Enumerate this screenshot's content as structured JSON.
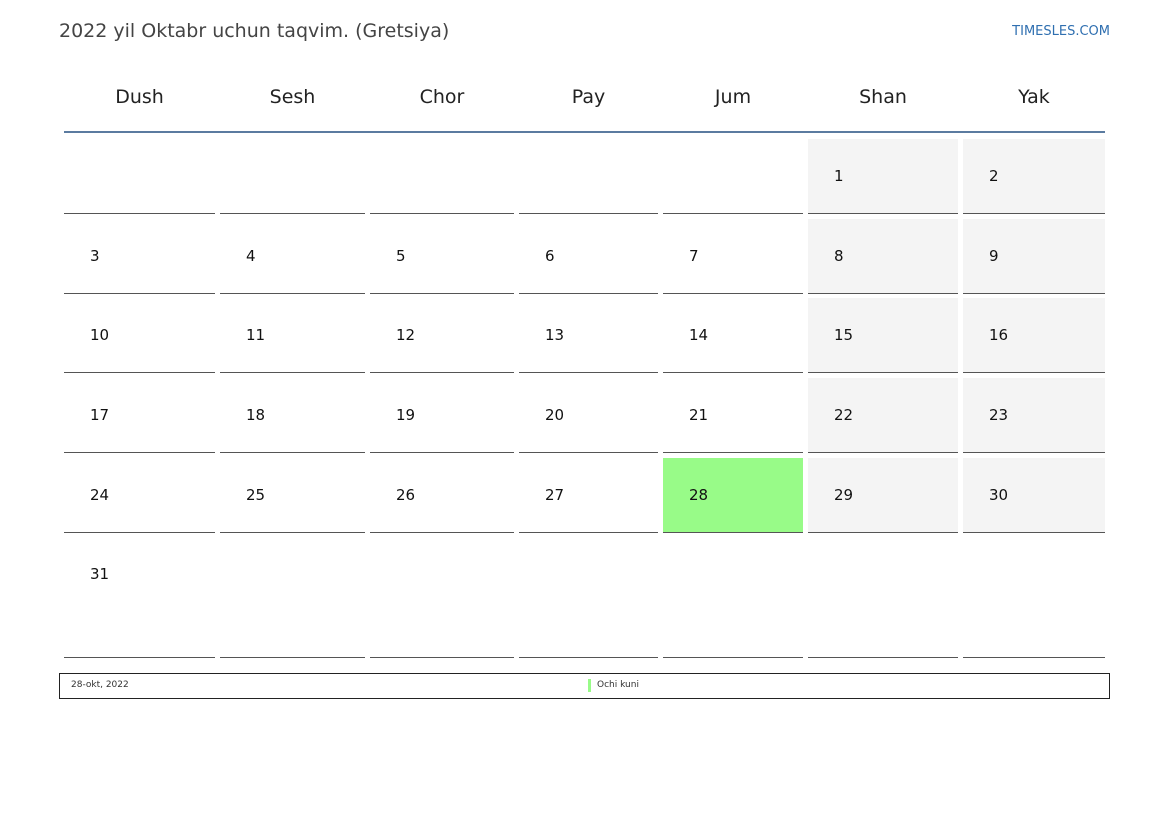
{
  "header": {
    "title": "2022 yil Oktabr uchun taqvim. (Gretsiya)",
    "site": "TIMESLES.COM"
  },
  "weekdays": [
    "Dush",
    "Sesh",
    "Chor",
    "Pay",
    "Jum",
    "Shan",
    "Yak"
  ],
  "weeks": [
    [
      "",
      "",
      "",
      "",
      "",
      "1",
      "2"
    ],
    [
      "3",
      "4",
      "5",
      "6",
      "7",
      "8",
      "9"
    ],
    [
      "10",
      "11",
      "12",
      "13",
      "14",
      "15",
      "16"
    ],
    [
      "17",
      "18",
      "19",
      "20",
      "21",
      "22",
      "23"
    ],
    [
      "24",
      "25",
      "26",
      "27",
      "28",
      "29",
      "30"
    ],
    [
      "31",
      "",
      "",
      "",
      "",
      "",
      ""
    ]
  ],
  "holidays": [
    "28"
  ],
  "colors": {
    "weekend": "#f4f4f4",
    "holiday": "#98fb88",
    "header_rule": "#5b7ba0",
    "link": "#2f6fb0"
  },
  "footer": {
    "date": "28-okt, 2022",
    "legend_label": "Ochi kuni"
  }
}
